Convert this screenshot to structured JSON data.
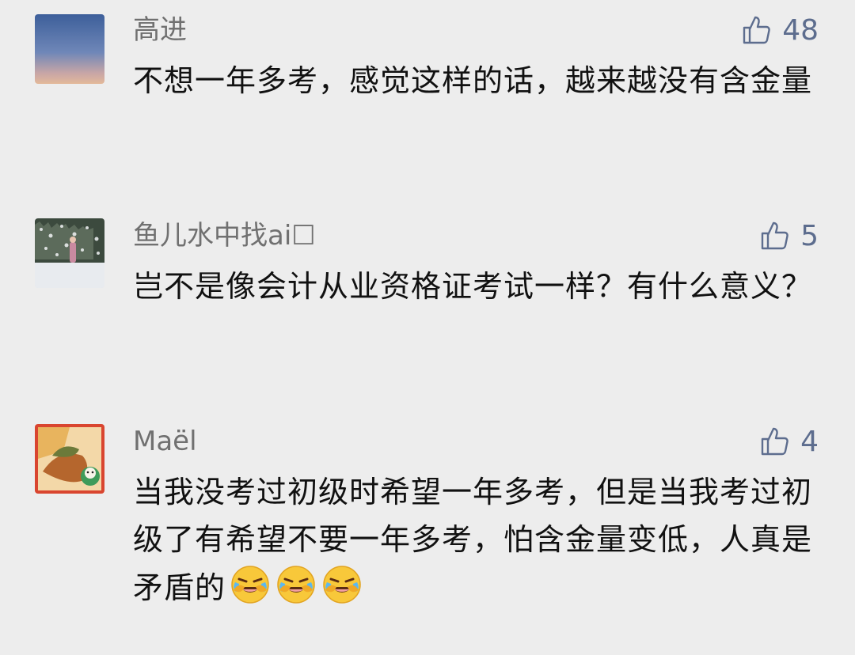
{
  "comments": [
    {
      "author": "高进",
      "likes": "48",
      "text": "不想一年多考，感觉这样的话，越来越没有含金量",
      "avatar_icon": "sky-photo-avatar"
    },
    {
      "author": "鱼儿水中找ai☐",
      "likes": "5",
      "text": "岂不是像会计从业资格证考试一样？有什么意义？",
      "avatar_icon": "snow-photo-avatar"
    },
    {
      "author": "Maël",
      "likes": "4",
      "text": "当我没考过初级时希望一年多考，但是当我考过初级了有希望不要一年多考，怕含金量变低，人真是矛盾的",
      "avatar_icon": "illustration-avatar",
      "emojis": [
        "laughing-crying-emoji",
        "laughing-crying-emoji",
        "laughing-crying-emoji"
      ]
    }
  ],
  "colors": {
    "background": "#ededed",
    "like_accent": "#5d6d8e",
    "author": "#707070"
  }
}
